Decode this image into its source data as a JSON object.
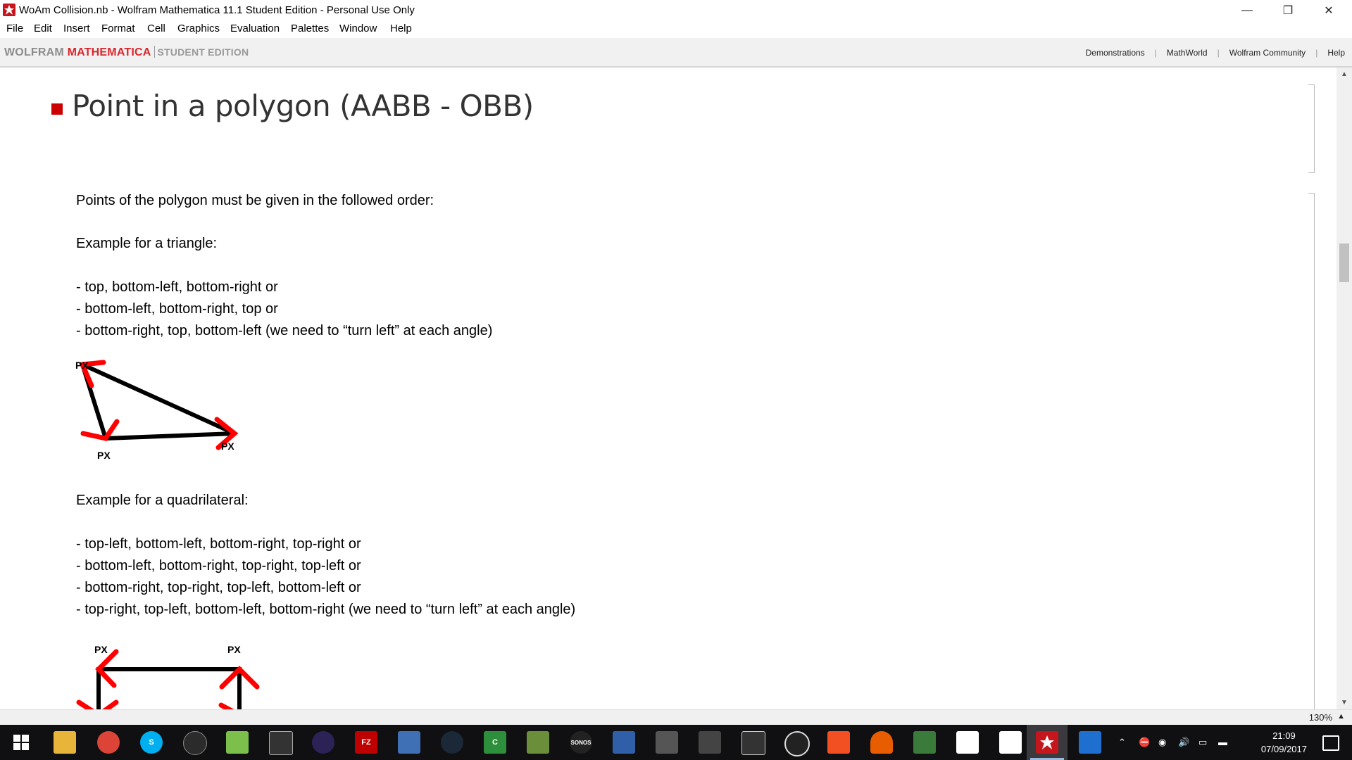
{
  "window": {
    "title": "WoAm Collision.nb - Wolfram Mathematica 11.1 Student Edition - Personal Use Only",
    "minimize": "—",
    "restore": "❐",
    "close": "✕"
  },
  "menu": [
    "File",
    "Edit",
    "Insert",
    "Format",
    "Cell",
    "Graphics",
    "Evaluation",
    "Palettes",
    "Window",
    "Help"
  ],
  "brand": {
    "wolfram": "WOLFRAM",
    "mathematica": "MATHEMATICA",
    "edition": "STUDENT EDITION"
  },
  "toolbar_links": [
    "Demonstrations",
    "MathWorld",
    "Wolfram Community",
    "Help"
  ],
  "notebook": {
    "section_title": "Point in a polygon (AABB - OBB)",
    "intro": "Points of the polygon must be given in the followed order:",
    "triangle_heading": "Example for a triangle:",
    "triangle_lines": [
      "- top, bottom-left, bottom-right or",
      "- bottom-left, bottom-right, top or",
      "- bottom-right, top, bottom-left (we need to “turn left” at each angle)"
    ],
    "quad_heading": "Example for a quadrilateral:",
    "quad_lines": [
      "- top-left, bottom-left, bottom-right, top-right or",
      "- bottom-left, bottom-right, top-right, top-left or",
      "- bottom-right, top-right, top-left, bottom-left or",
      "- top-right, top-left, bottom-left, bottom-right (we need to “turn left” at each angle)"
    ],
    "point_label": "PX"
  },
  "status": {
    "zoom": "130%"
  },
  "taskbar": {
    "time": "21:09",
    "date": "07/09/2017",
    "apps": [
      "windows-start",
      "file-explorer",
      "chrome",
      "skype",
      "steam-alt",
      "notepad-plus",
      "console",
      "eclipse",
      "filezilla",
      "paint",
      "steam",
      "camtasia",
      "minecraft",
      "sonos",
      "network",
      "sublime",
      "calculator",
      "remote",
      "obs",
      "winapp",
      "vlc",
      "hotspot",
      "flutter-life",
      "flutter-life-2",
      "mathematica",
      "remote-desktop"
    ],
    "accent": "#c4161c"
  }
}
